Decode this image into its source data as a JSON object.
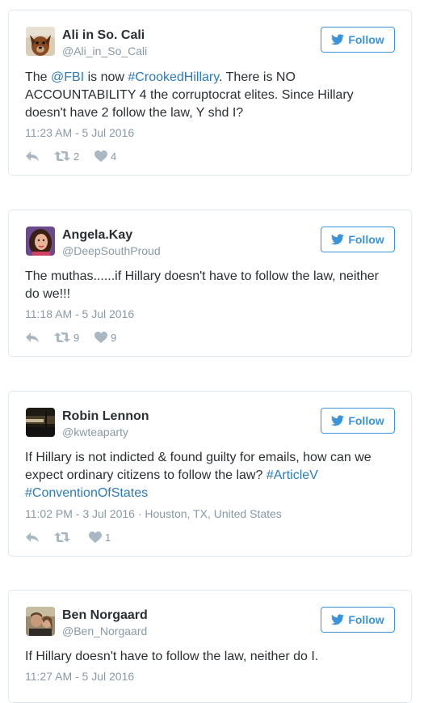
{
  "colors": {
    "link": "#2b7bb9",
    "follow": "#3b94d9",
    "muted": "#8899a6",
    "action_icon": "#a9b7c2"
  },
  "follow_label": "Follow",
  "tweets": [
    {
      "name": "Ali in So. Cali",
      "handle": "@Ali_in_So_Cali",
      "avatar": "dog-avatar",
      "text_parts": [
        {
          "t": "The ",
          "link": false
        },
        {
          "t": "@FBI",
          "link": true
        },
        {
          "t": " is now ",
          "link": false
        },
        {
          "t": "#CrookedHillary",
          "link": true
        },
        {
          "t": ". There is NO ACCOUNTABILITY 4 the corruptocrat elites. Since Hillary doesn't have 2 follow the law, Y shd I?",
          "link": false
        }
      ],
      "timestamp": "11:23 AM - 5 Jul 2016",
      "location": "",
      "retweets": "2",
      "likes": "4"
    },
    {
      "name": "Angela.Kay",
      "handle": "@DeepSouthProud",
      "avatar": "woman-avatar",
      "text_parts": [
        {
          "t": "The muthas......if Hillary doesn't have to follow the law, neither do we!!!",
          "link": false
        }
      ],
      "timestamp": "11:18 AM - 5 Jul 2016",
      "location": "",
      "retweets": "9",
      "likes": "9"
    },
    {
      "name": "Robin Lennon",
      "handle": "@kwteaparty",
      "avatar": "dark-landscape-avatar",
      "text_parts": [
        {
          "t": "If Hillary is not indicted & found guilty for emails, how can we expect ordinary citizens to follow the law? ",
          "link": false
        },
        {
          "t": "#ArticleV",
          "link": true
        },
        {
          "t": " ",
          "link": false
        },
        {
          "t": "#ConventionOfStates",
          "link": true
        }
      ],
      "timestamp": "11:02 PM - 3 Jul 2016",
      "location": "Houston, TX, United States",
      "retweets": "",
      "likes": "1"
    },
    {
      "name": "Ben Norgaard",
      "handle": "@Ben_Norgaard",
      "avatar": "man-avatar",
      "text_parts": [
        {
          "t": "If Hillary doesn't have to follow the law, neither do I.",
          "link": false
        }
      ],
      "timestamp": "11:27 AM - 5 Jul 2016",
      "location": "",
      "retweets": "",
      "likes": ""
    }
  ]
}
